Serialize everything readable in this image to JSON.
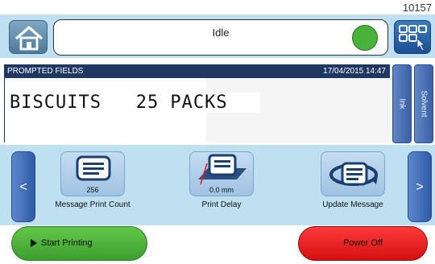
{
  "header": {
    "screen_id": "10157",
    "status": "Idle",
    "status_led_color": "#47b33a"
  },
  "prompted_fields": {
    "title": "PROMPTED FIELDS",
    "datetime": "17/04/2015  14:47",
    "message_line": "BISCUITS   25 PACKS"
  },
  "side_tabs": {
    "ink": "Ink",
    "solvent": "Solvent"
  },
  "nav": {
    "prev": "<",
    "next": ">"
  },
  "tiles": {
    "print_count": {
      "value": "256",
      "label": "Message Print Count"
    },
    "print_delay": {
      "value": "0.0 mm",
      "label": "Print Delay"
    },
    "update_message": {
      "label": "Update Message"
    }
  },
  "actions": {
    "start": "Start Printing",
    "power_off": "Power Off"
  },
  "colors": {
    "panel_bg": "#bfe0f0",
    "header_navy": "#1f3863",
    "start_green": "#4fb83c",
    "power_red": "#ee1c1c"
  }
}
